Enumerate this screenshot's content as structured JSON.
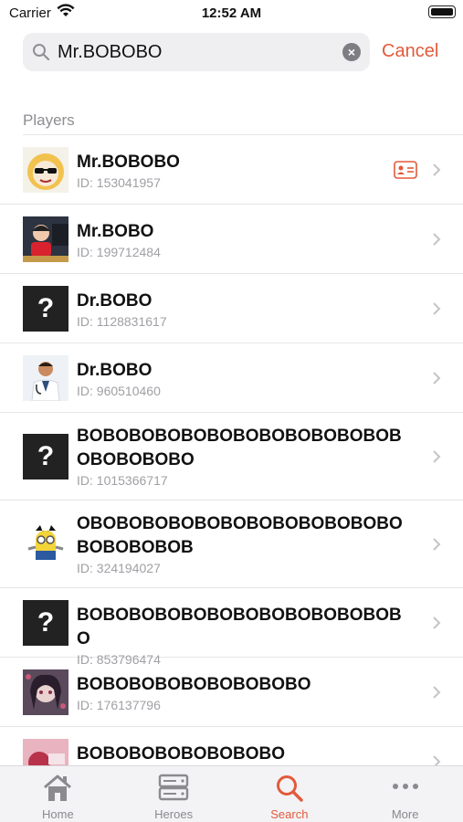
{
  "status": {
    "carrier": "Carrier",
    "time": "12:52 AM"
  },
  "search": {
    "value": "Mr.BOBOBO",
    "cancel_label": "Cancel"
  },
  "section_title": "Players",
  "players": [
    {
      "name": "Mr.BOBOBO",
      "id": "ID: 153041957",
      "avatar": "cartoon-sunglasses",
      "has_card": true
    },
    {
      "name": "Mr.BOBO",
      "id": "ID: 199712484",
      "avatar": "person-photo",
      "has_card": false
    },
    {
      "name": "Dr.BOBO",
      "id": "ID: 1128831617",
      "avatar": "question",
      "has_card": false
    },
    {
      "name": "Dr.BOBO",
      "id": "ID: 960510460",
      "avatar": "doctor",
      "has_card": false
    },
    {
      "name": "BOBOBOBOBOBOBOBOBOBOBOBOBOBOBOBOBO",
      "id": "ID: 1015366717",
      "avatar": "question",
      "has_card": false
    },
    {
      "name": "OBOBOBOBOBOBOBOBOBOBOBOBOBOBOBOBOB",
      "id": "ID: 324194027",
      "avatar": "minion",
      "has_card": false
    },
    {
      "name": "BOBOBOBOBOBOBOBOBOBOBOBOBO",
      "id": "ID: 853796474",
      "avatar": "question",
      "has_card": false
    },
    {
      "name": "BOBOBOBOBOBOBOBOBO",
      "id": "ID: 176137796",
      "avatar": "anime",
      "has_card": false
    },
    {
      "name": "BOBOBOBOBOBOBOBO",
      "id": "",
      "avatar": "pink-photo",
      "has_card": false
    }
  ],
  "tabs": [
    {
      "label": "Home",
      "icon": "home-icon"
    },
    {
      "label": "Heroes",
      "icon": "server-icon"
    },
    {
      "label": "Search",
      "icon": "search-icon",
      "active": true
    },
    {
      "label": "More",
      "icon": "more-icon"
    }
  ],
  "colors": {
    "accent": "#e25a3b",
    "secondary_text": "#a0a0a5"
  }
}
